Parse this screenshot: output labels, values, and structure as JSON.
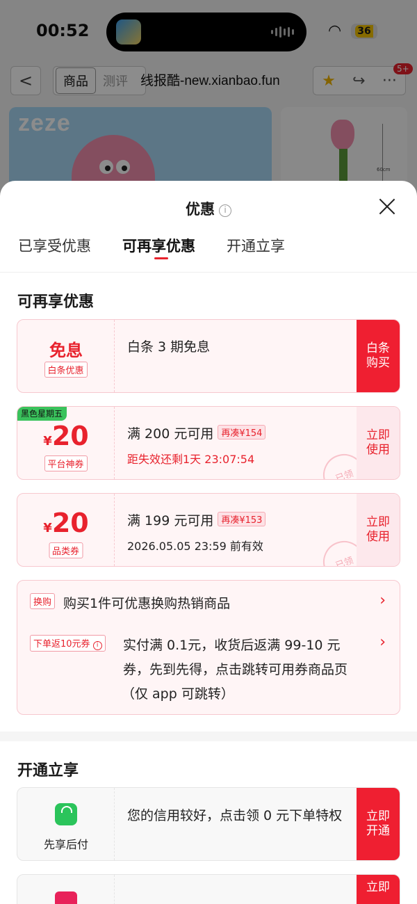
{
  "status_bar": {
    "time": "00:52",
    "battery": "36"
  },
  "nav": {
    "back_label": "<",
    "tabs": [
      {
        "label": "商品",
        "active": true
      },
      {
        "label": "测评",
        "active": false
      }
    ],
    "watermark": "线报酷-new.xianbao.fun",
    "notification_count": "5+"
  },
  "product": {
    "brand_text": "zeze",
    "size_label": "60cm"
  },
  "sheet": {
    "title": "优惠",
    "info_icon": "i",
    "tabs": [
      {
        "label": "已享受优惠",
        "active": false
      },
      {
        "label": "可再享优惠",
        "active": true
      },
      {
        "label": "开通立享",
        "active": false
      }
    ]
  },
  "more_offers": {
    "title": "可再享优惠",
    "baitiao": {
      "word": "免息",
      "tag": "白条优惠",
      "text": "白条 3 期免息",
      "action": "白条\n购买"
    },
    "coupon1": {
      "badge": "黑色星期五",
      "currency": "¥",
      "amount": "20",
      "tag": "平台神券",
      "condition": "满 200 元可用",
      "recoup": "再凑¥154",
      "expiry": "距失效还剩1天 23:07:54",
      "action": "立即\n使用",
      "stamp": "已领"
    },
    "coupon2": {
      "currency": "¥",
      "amount": "20",
      "tag": "品类券",
      "condition": "满 199 元可用",
      "recoup": "再凑¥153",
      "expiry": "2026.05.05 23:59 前有效",
      "action": "立即\n使用",
      "stamp": "已领"
    },
    "promo": {
      "exchange": {
        "chip": "换购",
        "text": "购买1件可优惠换购热销商品"
      },
      "rebate": {
        "chip": "下单返10元券",
        "chip_info": "i",
        "line1": "实付满 0.1元，收货后返满 99-10 元",
        "line2": "券，先到先得，点击跳转可用券商品页",
        "line3": "（仅 app 可跳转）"
      }
    }
  },
  "open_section": {
    "title": "开通立享",
    "pay_later": {
      "label": "先享后付",
      "text": "您的信用较好，点击领 0 元下单特权",
      "action": "立即\n开通"
    },
    "next_action": "立即"
  },
  "colors": {
    "accent": "#e8222d",
    "solid_button": "#ef1f31",
    "card_bg": "#fff5f6",
    "card_border": "#f7c8cf",
    "green_badge": "#3ac25c"
  }
}
